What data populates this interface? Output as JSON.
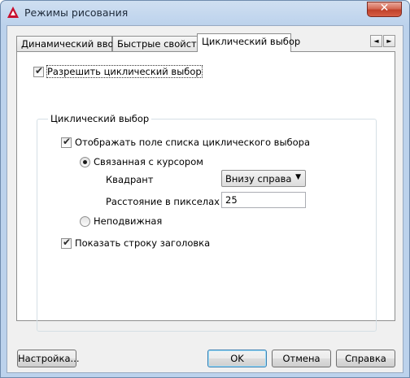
{
  "window": {
    "title": "Режимы рисования"
  },
  "tabs": [
    {
      "label": "Динамический ввод",
      "active": false
    },
    {
      "label": "Быстрые свойства",
      "active": false
    },
    {
      "label": "Циклический выбор",
      "active": true
    }
  ],
  "tab_scroll": {
    "left": "◄",
    "right": "►"
  },
  "enable_cycling": {
    "label": "Разрешить циклический выбор",
    "checked": true
  },
  "group": {
    "title": "Циклический выбор",
    "show_list": {
      "label": "Отображать поле списка циклического выбора",
      "checked": true
    },
    "radio_cursor": {
      "label": "Связанная с курсором",
      "selected": true
    },
    "quadrant": {
      "label": "Квадрант",
      "value": "Внизу справа"
    },
    "distance": {
      "label": "Расстояние в пикселах",
      "value": "25"
    },
    "radio_static": {
      "label": "Неподвижная",
      "selected": false
    },
    "show_title": {
      "label": "Показать строку заголовка",
      "checked": true
    }
  },
  "buttons": {
    "settings": "Настройка...",
    "ok": "OK",
    "cancel": "Отмена",
    "help": "Справка"
  },
  "colors": {
    "accent": "#c0412a",
    "frame": "#bcd2ec"
  }
}
